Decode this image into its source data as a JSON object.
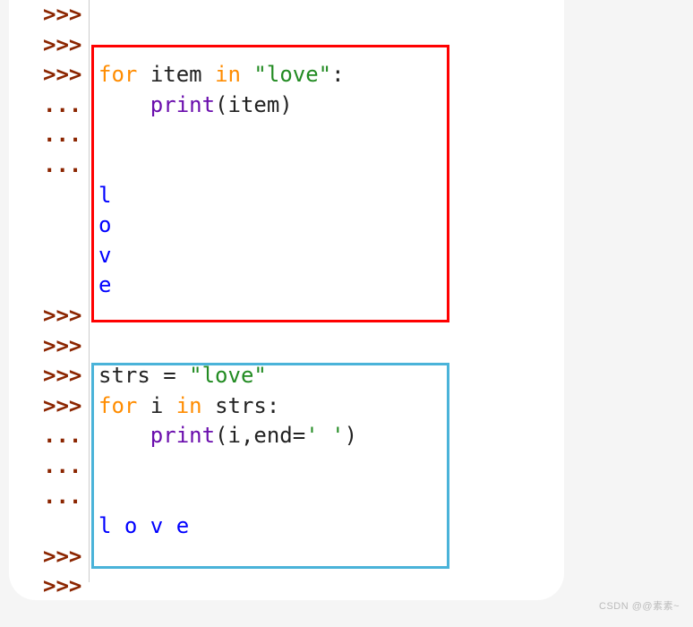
{
  "prompts": {
    "ps1": ">>>",
    "ps2": "..."
  },
  "block1": {
    "line1": {
      "kw_for": "for",
      "var_item": "item",
      "kw_in": "in",
      "str": "\"love\"",
      "colon": ":"
    },
    "line2": {
      "indent": "    ",
      "fn": "print",
      "open": "(",
      "arg": "item",
      "close": ")"
    },
    "out": [
      "l",
      "o",
      "v",
      "e"
    ]
  },
  "block2": {
    "line1": {
      "var": "strs",
      "eq": " = ",
      "str": "\"love\""
    },
    "line2": {
      "kw_for": "for",
      "var_i": "i",
      "kw_in": "in",
      "var_strs": "strs",
      "colon": ":"
    },
    "line3": {
      "indent": "    ",
      "fn": "print",
      "open": "(",
      "arg1": "i",
      "comma": ",",
      "kw_end": "end",
      "eq": "=",
      "str": "' '",
      "close": ")"
    },
    "out": "l o v e "
  },
  "watermark": "CSDN @@素素~",
  "colors": {
    "prompt": "#8B2500",
    "keyword": "#ff8c00",
    "string": "#228B22",
    "function": "#6a0dad",
    "output": "#0000ff",
    "box_red": "#ff0000",
    "box_blue": "#4ab3d9"
  }
}
